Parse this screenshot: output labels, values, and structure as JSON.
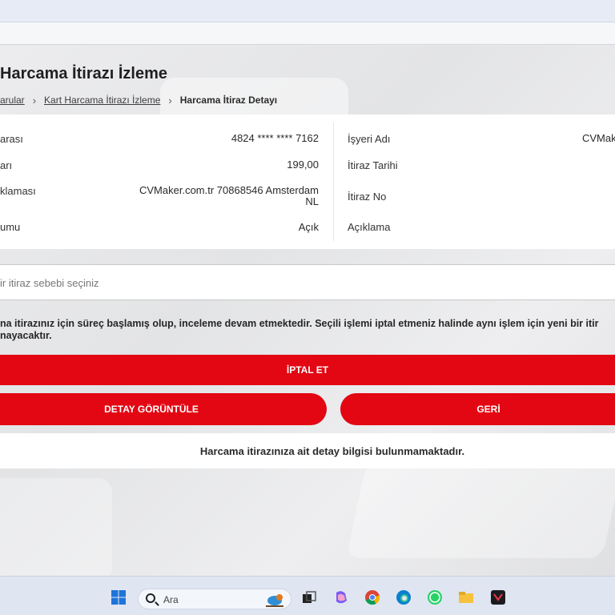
{
  "page": {
    "title": "Harcama İtirazı İzleme",
    "breadcrumb": {
      "first": "arular",
      "second": "Kart Harcama İtirazı İzleme",
      "current": "Harcama İtiraz Detayı"
    }
  },
  "details": {
    "left": [
      {
        "label": "arası",
        "value": "4824 **** **** 7162"
      },
      {
        "label": "arı",
        "value": "199,00"
      },
      {
        "label": "klaması",
        "value_line1": "CVMaker.com.tr 70868546 Amsterdam",
        "value_line2": "NL"
      },
      {
        "label": "umu",
        "value": "Açık"
      }
    ],
    "right": [
      {
        "label": "İşyeri Adı",
        "value": "CVMak"
      },
      {
        "label": "İtiraz Tarihi",
        "value": ""
      },
      {
        "label": "İtiraz No",
        "value": ""
      },
      {
        "label": "Açıklama",
        "value": ""
      }
    ]
  },
  "reason_select": {
    "placeholder": "ir itiraz sebebi seçiniz"
  },
  "info_message": {
    "line1": "na itirazınız için süreç başlamış olup, inceleme devam etmektedir. Seçili işlemi iptal etmeniz halinde aynı işlem için yeni bir itir",
    "line2": "nayacaktır."
  },
  "buttons": {
    "cancel": "İPTAL ET",
    "view_detail": "DETAY GÖRÜNTÜLE",
    "back": "GERİ"
  },
  "empty_state": "Harcama itirazınıza ait detay bilgisi bulunmamaktadır.",
  "taskbar": {
    "search_placeholder": "Ara",
    "icons": [
      "windows-start-icon",
      "search-icon",
      "task-view-icon",
      "copilot-icon",
      "chrome-icon",
      "edge-icon",
      "whatsapp-icon",
      "file-explorer-icon",
      "media-app-icon"
    ]
  },
  "colors": {
    "accent": "#e30613",
    "page_bg": "#e9e9eb",
    "card_bg": "#ffffff",
    "taskbar_bg": "#dfe6f2"
  }
}
